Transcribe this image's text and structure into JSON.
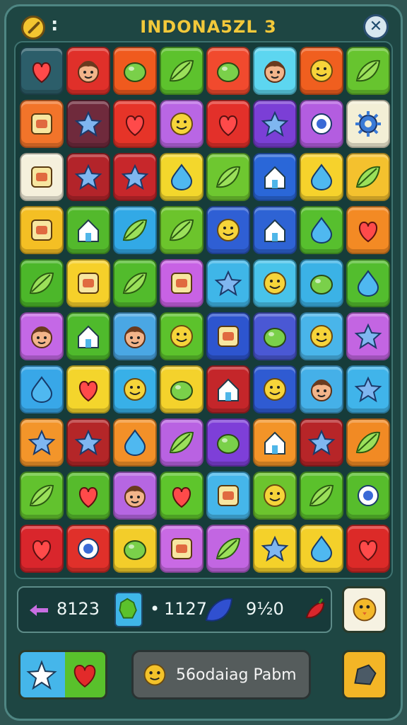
{
  "header": {
    "title": "INDONA5ZL 3",
    "colon": ":"
  },
  "board": {
    "rows": [
      [
        {
          "c": "#2c5e6a",
          "i": "heart"
        },
        {
          "c": "#e0302a",
          "i": "face"
        },
        {
          "c": "#f05a1e",
          "i": "blob"
        },
        {
          "c": "#5dc22d",
          "i": "leaf"
        },
        {
          "c": "#f14a2e",
          "i": "blob"
        },
        {
          "c": "#5dd6f0",
          "i": "face"
        },
        {
          "c": "#f05f1f",
          "i": "smile"
        },
        {
          "c": "#67c42f",
          "i": "leaf"
        }
      ],
      [
        {
          "c": "#f2742a",
          "i": "square"
        },
        {
          "c": "#6f2a3c",
          "i": "star"
        },
        {
          "c": "#e63428",
          "i": "heart"
        },
        {
          "c": "#b966e4",
          "i": "smile"
        },
        {
          "c": "#e3302a",
          "i": "heart"
        },
        {
          "c": "#7b3fd6",
          "i": "star"
        },
        {
          "c": "#b35de0",
          "i": "ring"
        },
        {
          "c": "#f3efd6",
          "i": "gear"
        }
      ],
      [
        {
          "c": "#f5f0dc",
          "i": "square"
        },
        {
          "c": "#b3242a",
          "i": "star"
        },
        {
          "c": "#c7272b",
          "i": "star"
        },
        {
          "c": "#f3d72c",
          "i": "drop"
        },
        {
          "c": "#6ec730",
          "i": "leaf"
        },
        {
          "c": "#2a67d8",
          "i": "house"
        },
        {
          "c": "#f6d22c",
          "i": "drop"
        },
        {
          "c": "#f4c12e",
          "i": "leaf"
        }
      ],
      [
        {
          "c": "#f4bf24",
          "i": "square"
        },
        {
          "c": "#53b92c",
          "i": "house"
        },
        {
          "c": "#32a9e6",
          "i": "leaf"
        },
        {
          "c": "#6cc42c",
          "i": "leaf"
        },
        {
          "c": "#2f5fd4",
          "i": "smile"
        },
        {
          "c": "#2e63d4",
          "i": "house"
        },
        {
          "c": "#57bf2e",
          "i": "drop"
        },
        {
          "c": "#f38a24",
          "i": "heart"
        }
      ],
      [
        {
          "c": "#4cb72a",
          "i": "leaf"
        },
        {
          "c": "#f6d02a",
          "i": "square"
        },
        {
          "c": "#52bb2c",
          "i": "leaf"
        },
        {
          "c": "#c862e4",
          "i": "square"
        },
        {
          "c": "#3fb6e8",
          "i": "star"
        },
        {
          "c": "#48c3ea",
          "i": "smile"
        },
        {
          "c": "#3bb2e6",
          "i": "blob"
        },
        {
          "c": "#53bd2e",
          "i": "drop"
        }
      ],
      [
        {
          "c": "#c468e6",
          "i": "face"
        },
        {
          "c": "#4fba2c",
          "i": "house"
        },
        {
          "c": "#4aa7e4",
          "i": "face"
        },
        {
          "c": "#5cc22c",
          "i": "smile"
        },
        {
          "c": "#2d55cf",
          "i": "square"
        },
        {
          "c": "#4a58d4",
          "i": "blob"
        },
        {
          "c": "#49b5ea",
          "i": "smile"
        },
        {
          "c": "#c365e2",
          "i": "star"
        }
      ],
      [
        {
          "c": "#38a7e8",
          "i": "drop"
        },
        {
          "c": "#f4d52c",
          "i": "heart"
        },
        {
          "c": "#38b0e8",
          "i": "smile"
        },
        {
          "c": "#f4d22c",
          "i": "blob"
        },
        {
          "c": "#c4262a",
          "i": "house"
        },
        {
          "c": "#2f5bd2",
          "i": "smile"
        },
        {
          "c": "#45b0e8",
          "i": "face"
        },
        {
          "c": "#40b4ea",
          "i": "star"
        }
      ],
      [
        {
          "c": "#f3952a",
          "i": "star"
        },
        {
          "c": "#b42628",
          "i": "star"
        },
        {
          "c": "#f39028",
          "i": "drop"
        },
        {
          "c": "#b962e2",
          "i": "leaf"
        },
        {
          "c": "#7e3fd8",
          "i": "blob"
        },
        {
          "c": "#f39428",
          "i": "house"
        },
        {
          "c": "#b72528",
          "i": "star"
        },
        {
          "c": "#f18a24",
          "i": "leaf"
        }
      ],
      [
        {
          "c": "#62c22e",
          "i": "leaf"
        },
        {
          "c": "#56bb2c",
          "i": "heart"
        },
        {
          "c": "#b666e2",
          "i": "face"
        },
        {
          "c": "#5ec52c",
          "i": "heart"
        },
        {
          "c": "#45b6ea",
          "i": "square"
        },
        {
          "c": "#6cc42e",
          "i": "smile"
        },
        {
          "c": "#5bc12c",
          "i": "leaf"
        },
        {
          "c": "#57bd2c",
          "i": "ring"
        }
      ],
      [
        {
          "c": "#d9262c",
          "i": "heart"
        },
        {
          "c": "#e0302a",
          "i": "ring"
        },
        {
          "c": "#f3cd2a",
          "i": "blob"
        },
        {
          "c": "#c96ae4",
          "i": "square"
        },
        {
          "c": "#c266e2",
          "i": "leaf"
        },
        {
          "c": "#f4d12a",
          "i": "star"
        },
        {
          "c": "#f4d02a",
          "i": "drop"
        },
        {
          "c": "#dc2a28",
          "i": "heart"
        }
      ]
    ]
  },
  "stats": {
    "stat1": "8123",
    "stat2": "1127",
    "stat2_prefix": "•",
    "stat3": "9½0"
  },
  "message": {
    "text": "56odaiag Pabm"
  },
  "colors": {
    "accent_gold": "#f2c93a",
    "frame": "#1e4643",
    "board": "#163c3a"
  }
}
